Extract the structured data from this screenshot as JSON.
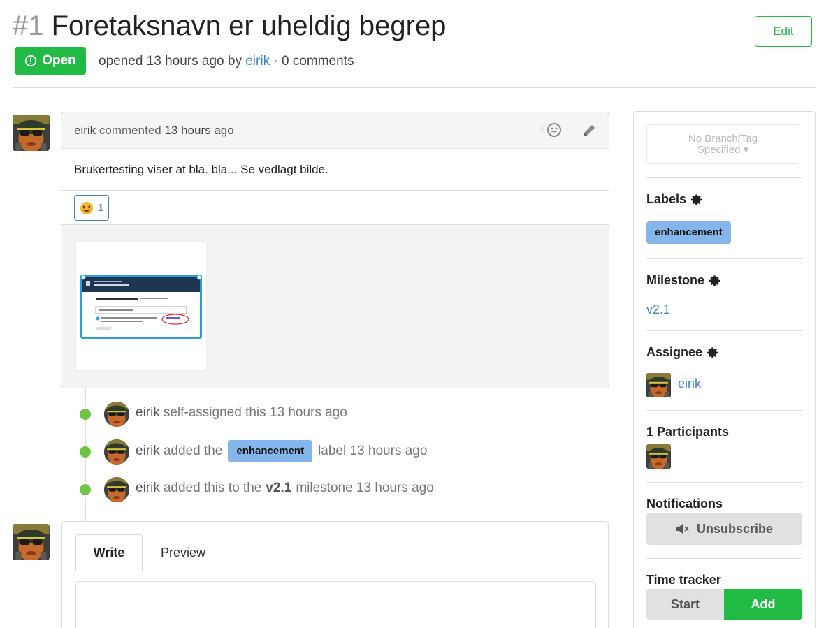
{
  "issue": {
    "number": "#1",
    "title": "Foretaksnavn er uheldig begrep",
    "status": "Open",
    "meta_opened": "opened 13 hours ago by",
    "meta_author": "eirik",
    "meta_comments": "· 0 comments",
    "edit_label": "Edit"
  },
  "comment": {
    "author": "eirik",
    "action": "commented",
    "time": "13 hours ago",
    "body": "Brukertesting viser at bla. bla... Se vedlagt bilde.",
    "reaction_count": "1",
    "react_plus": "+"
  },
  "timeline": [
    {
      "user": "eirik",
      "pre": "self-assigned this 13 hours ago",
      "label": "",
      "post": ""
    },
    {
      "user": "eirik",
      "pre": "added the",
      "label": "enhancement",
      "post": "label 13 hours ago"
    },
    {
      "user": "eirik",
      "pre": "added this to the",
      "bold": "v2.1",
      "post": "milestone 13 hours ago"
    }
  ],
  "editor": {
    "tab_write": "Write",
    "tab_preview": "Preview"
  },
  "sidebar": {
    "branch_line1": "No Branch/Tag",
    "branch_line2": "Specified",
    "labels_title": "Labels",
    "label": "enhancement",
    "milestone_title": "Milestone",
    "milestone": "v2.1",
    "assignee_title": "Assignee",
    "assignee": "eirik",
    "participants_title": "1 Participants",
    "notifications_title": "Notifications",
    "unsubscribe": "Unsubscribe",
    "time_tracker_title": "Time tracker",
    "start": "Start",
    "add": "Add"
  },
  "colors": {
    "green": "#21ba45",
    "link": "#4183c4",
    "label_bg": "#84b6eb",
    "timeline_dot": "#6cc644"
  }
}
